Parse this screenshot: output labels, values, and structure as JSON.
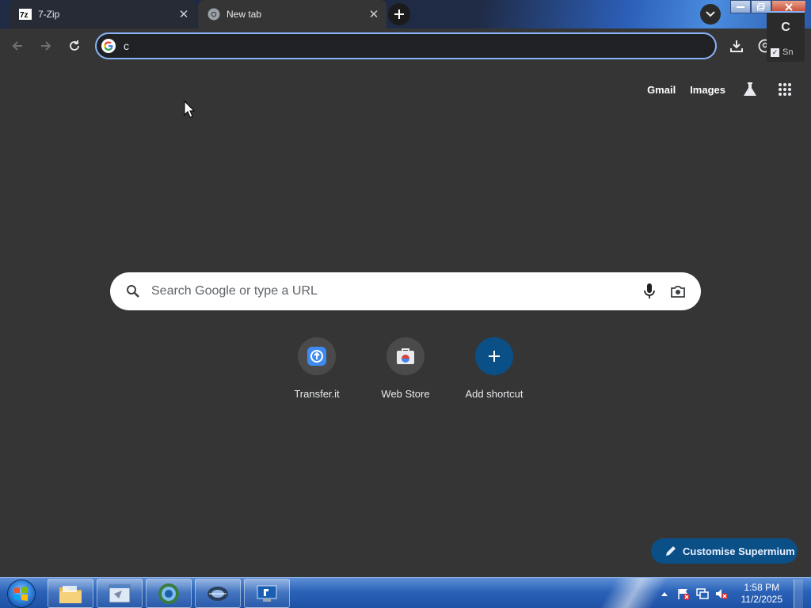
{
  "tabs": [
    {
      "label": "7-Zip",
      "icon": "7zip-icon",
      "active": false
    },
    {
      "label": "New tab",
      "icon": "chrome-icon",
      "active": true
    }
  ],
  "close_glyph": "✕",
  "omnibox": {
    "value": "c",
    "placeholder": ""
  },
  "popup": {
    "letter": "C",
    "checkbox_label": "Sn"
  },
  "ntp": {
    "links": {
      "gmail": "Gmail",
      "images": "Images"
    },
    "search_placeholder": "Search Google or type a URL",
    "shortcuts": [
      {
        "label": "Transfer.it",
        "icon": "transfer-icon"
      },
      {
        "label": "Web Store",
        "icon": "webstore-icon"
      },
      {
        "label": "Add shortcut",
        "icon": "plus-icon"
      }
    ],
    "customise_label": "Customise Supermium"
  },
  "taskbar": {
    "apps": [
      "explorer-icon",
      "ie-icon",
      "chrome-icon",
      "network-icon",
      "remote-desktop-icon"
    ],
    "clock": {
      "time": "1:58 PM",
      "date": "11/2/2025"
    }
  },
  "colors": {
    "accent": "#8ab4f8",
    "page_bg": "#353535",
    "button_blue": "#0b4f87"
  }
}
